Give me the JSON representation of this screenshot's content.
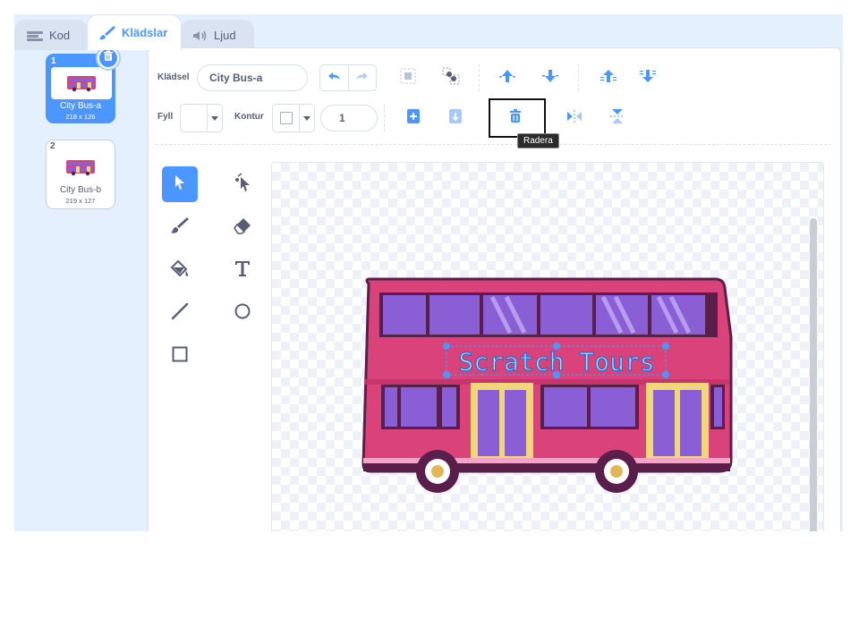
{
  "tabs": [
    {
      "label": "Kod",
      "icon": "code-icon"
    },
    {
      "label": "Klädslar",
      "icon": "paintbrush-icon",
      "active": true
    },
    {
      "label": "Ljud",
      "icon": "speaker-icon"
    }
  ],
  "costumes": [
    {
      "number": "1",
      "name": "City Bus-a",
      "size": "218 x 126",
      "selected": true
    },
    {
      "number": "2",
      "name": "City Bus-b",
      "size": "219 x 127",
      "selected": false
    }
  ],
  "toolbar": {
    "costume_label": "Klädsel",
    "costume_name": "City Bus-a",
    "fill_label": "Fyll",
    "outline_label": "Kontur",
    "outline_width": "1",
    "tooltip": "Radera",
    "colors": {
      "accent": "#4c97ff",
      "text": "#575e75"
    }
  },
  "canvas": {
    "sign_text": "Scratch Tours"
  }
}
